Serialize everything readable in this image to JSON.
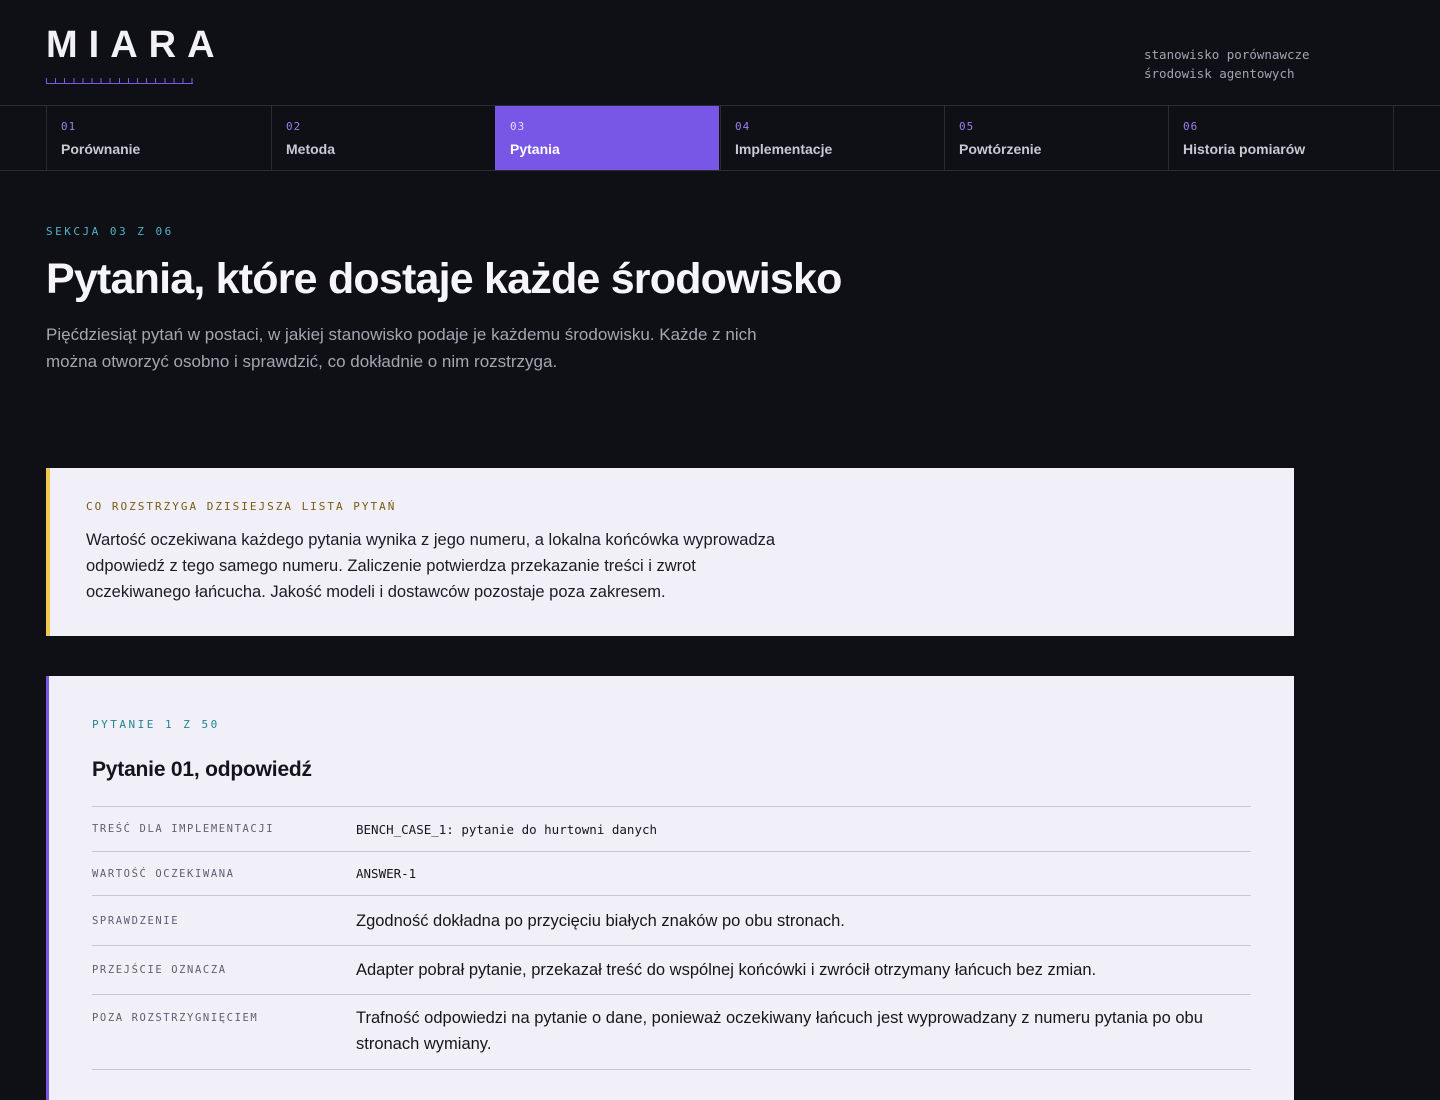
{
  "header": {
    "logo": "MIARA",
    "tagline_line1": "stanowisko porównawcze",
    "tagline_line2": "środowisk agentowych"
  },
  "nav": {
    "items": [
      {
        "num": "01",
        "label": "Porównanie"
      },
      {
        "num": "02",
        "label": "Metoda"
      },
      {
        "num": "03",
        "label": "Pytania",
        "active": true
      },
      {
        "num": "04",
        "label": "Implementacje"
      },
      {
        "num": "05",
        "label": "Powtórzenie"
      },
      {
        "num": "06",
        "label": "Historia pomiarów"
      }
    ]
  },
  "intro": {
    "eyebrow": "SEKCJA 03 Z 06",
    "title": "Pytania, które dostaje każde środowisko",
    "lede": "Pięćdziesiąt pytań w postaci, w jakiej stanowisko podaje je każdemu środowisku. Każde z nich można otworzyć osobno i sprawdzić, co dokładnie o nim rozstrzyga."
  },
  "scope": {
    "eyebrow": "CO ROZSTRZYGA DZISIEJSZA LISTA PYTAŃ",
    "text": "Wartość oczekiwana każdego pytania wynika z jego numeru, a lokalna końcówka wyprowadza odpowiedź z tego samego numeru. Zaliczenie potwierdza przekazanie treści i zwrot oczekiwanego łańcucha. Jakość modeli i dostawców pozostaje poza zakresem."
  },
  "question": {
    "eyebrow": "PYTANIE 1 Z 50",
    "title": "Pytanie 01, odpowiedź",
    "rows": [
      {
        "key": "TREŚĆ DLA IMPLEMENTACJI",
        "value": "BENCH_CASE_1: pytanie do hurtowni danych"
      },
      {
        "key": "WARTOŚĆ OCZEKIWANA",
        "value": "ANSWER-1"
      },
      {
        "key": "SPRAWDZENIE",
        "value": "Zgodność dokładna po przycięciu białych znaków po obu stronach."
      },
      {
        "key": "PRZEJŚCIE OZNACZA",
        "value": "Adapter pobrał pytanie, przekazał treść do wspólnej końcówki i zwrócił otrzymany łańcuch bez zmian."
      },
      {
        "key": "POZA ROZSTRZYGNIĘCIEM",
        "value": "Trafność odpowiedzi na pytanie o dane, ponieważ oczekiwany łańcuch jest wyprowadzany z numeru pytania po obu stronach wymiany."
      }
    ]
  },
  "colors": {
    "accent": "#7856e6",
    "scope_bar": "#f2c94c",
    "eyebrow": "#4fb3c8"
  }
}
